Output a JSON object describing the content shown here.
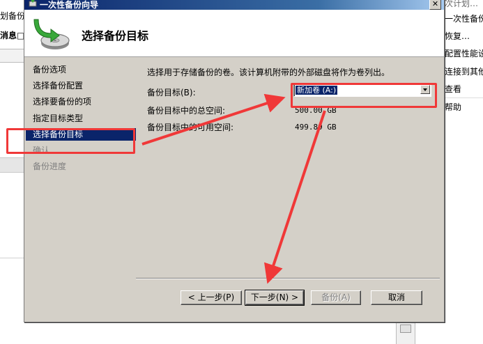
{
  "background": {
    "left_partial_texts": [
      "划备份",
      "消息□"
    ],
    "right_partial_actions": [
      "次计划…",
      "一次性备份…",
      "恢复…",
      "配置性能设…",
      "连接到其他…",
      "查看",
      "帮助"
    ]
  },
  "dialog": {
    "title": "一次性备份向导",
    "close_label": "✕",
    "header_title": "选择备份目标",
    "nav_items": [
      {
        "label": "备份选项",
        "state": "normal"
      },
      {
        "label": "选择备份配置",
        "state": "normal"
      },
      {
        "label": "选择要备份的项",
        "state": "normal"
      },
      {
        "label": "指定目标类型",
        "state": "normal"
      },
      {
        "label": "选择备份目标",
        "state": "active"
      },
      {
        "label": "确认",
        "state": "disabled"
      },
      {
        "label": "备份进度",
        "state": "disabled"
      }
    ],
    "content": {
      "description": "选择用于存储备份的卷。该计算机附带的外部磁盘将作为卷列出。",
      "target_label": "备份目标(B):",
      "target_value": "新加卷 (A:)",
      "total_space_label": "备份目标中的总空间:",
      "total_space_value": "500.00 GB",
      "free_space_label": "备份目标中的可用空间:",
      "free_space_value": "499.89 GB"
    },
    "buttons": {
      "back": "< 上一步(P)",
      "next": "下一步(N) >",
      "backup": "备份(A)",
      "cancel": "取消"
    }
  },
  "colors": {
    "annotation": "#f03838",
    "selection": "#0a246a",
    "dialog_face": "#d4d0c8"
  }
}
